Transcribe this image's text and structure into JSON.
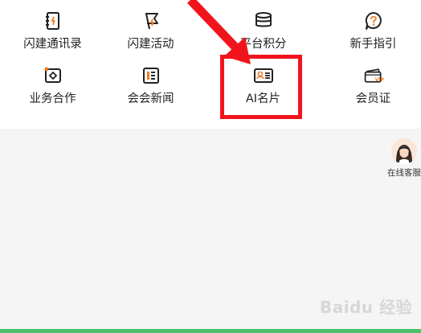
{
  "menu": {
    "items": [
      {
        "label": "闪建通讯录",
        "icon": "contacts-book-icon"
      },
      {
        "label": "闪建活动",
        "icon": "flag-icon"
      },
      {
        "label": "平台积分",
        "icon": "coin-stack-icon"
      },
      {
        "label": "新手指引",
        "icon": "question-bubble-icon"
      },
      {
        "label": "业务合作",
        "icon": "handshake-diamond-icon"
      },
      {
        "label": "会会新闻",
        "icon": "news-icon"
      },
      {
        "label": "AI名片",
        "icon": "business-card-icon"
      },
      {
        "label": "会员证",
        "icon": "vip-card-icon"
      }
    ]
  },
  "service": {
    "label": "在线客服",
    "icon": "customer-service-avatar"
  },
  "watermark": "Baidu 经验",
  "colors": {
    "highlight": "#f2141c",
    "accent_orange": "#f07a1f",
    "bottom_bar": "#4cc16c"
  }
}
